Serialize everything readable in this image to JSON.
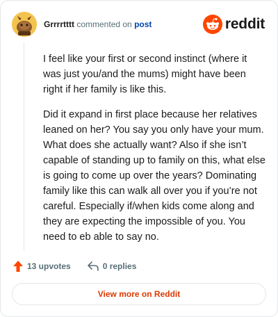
{
  "header": {
    "author": "Grrrrtttt",
    "verb": "commented on",
    "post_link": "post",
    "logo_text": "reddit"
  },
  "comment": {
    "paragraphs": [
      "I feel like your first or second instinct (where it was just you/and the mums) might have been right if her family is like this.",
      "Did it expand in first place because her relatives leaned on her? You say you only have your mum. What does she actually want? Also if she isn’t capable of standing up to family on this, what else is going to come up over the years? Dominating family like this can walk all over you if you’re not careful. Especially if/when kids come along and they are expecting the impossible of you. You need to eb able to say no."
    ]
  },
  "actions": {
    "upvotes": "13 upvotes",
    "replies": "0 replies"
  },
  "footer": {
    "view_more": "View more on Reddit"
  },
  "colors": {
    "accent": "#d93a00",
    "upvote": "#ff4500",
    "link": "#0045ac",
    "muted": "#576f76",
    "border": "#e3e6e8"
  },
  "icons": {
    "avatar": "snoo-avatar",
    "logo": "reddit-logo-icon",
    "upvote": "upvote-arrow-icon",
    "reply": "reply-arrow-icon"
  }
}
